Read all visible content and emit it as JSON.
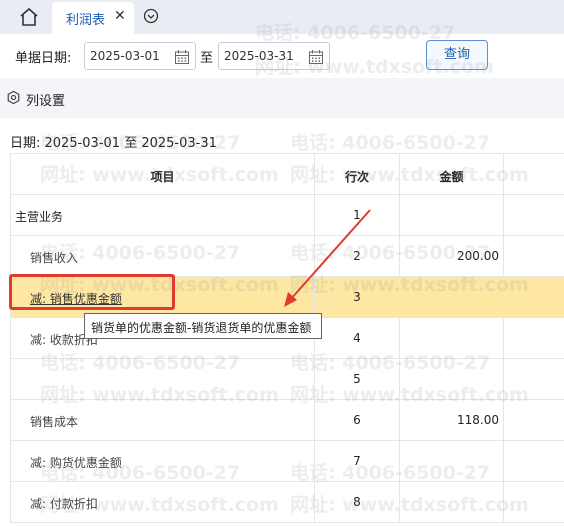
{
  "tabs": [
    {
      "label": "利润表",
      "close": "✕"
    }
  ],
  "filter": {
    "label": "单据日期:",
    "start": "2025-03-01",
    "to": "至",
    "end": "2025-03-31",
    "query": "查询"
  },
  "column_settings": "列设置",
  "date_range": "日期: 2025-03-01 至 2025-03-31",
  "table": {
    "headers": {
      "item": "项目",
      "row": "行次",
      "amount": "金额"
    },
    "rows": [
      {
        "item": "主营业务",
        "row": "1",
        "amount": ""
      },
      {
        "item": "销售收入",
        "row": "2",
        "amount": "200.00"
      },
      {
        "item": "减: 销售优惠金额",
        "row": "3",
        "amount": ""
      },
      {
        "item": "减: 收款折扣",
        "row": "4",
        "amount": ""
      },
      {
        "item": "",
        "row": "5",
        "amount": ""
      },
      {
        "item": "销售成本",
        "row": "6",
        "amount": "118.00"
      },
      {
        "item": "减: 购货优惠金额",
        "row": "7",
        "amount": ""
      },
      {
        "item": "减: 付款折扣",
        "row": "8",
        "amount": ""
      }
    ]
  },
  "tooltip": "销货单的优惠金额-销货退货单的优惠金额",
  "watermark": {
    "phone": "电话: 4006-6500-27",
    "site": "网址: www.tdxsoft.com"
  },
  "colors": {
    "accent": "#1a5fb4",
    "highlight": "#fde7a2",
    "annotation": "#e23b2e"
  }
}
